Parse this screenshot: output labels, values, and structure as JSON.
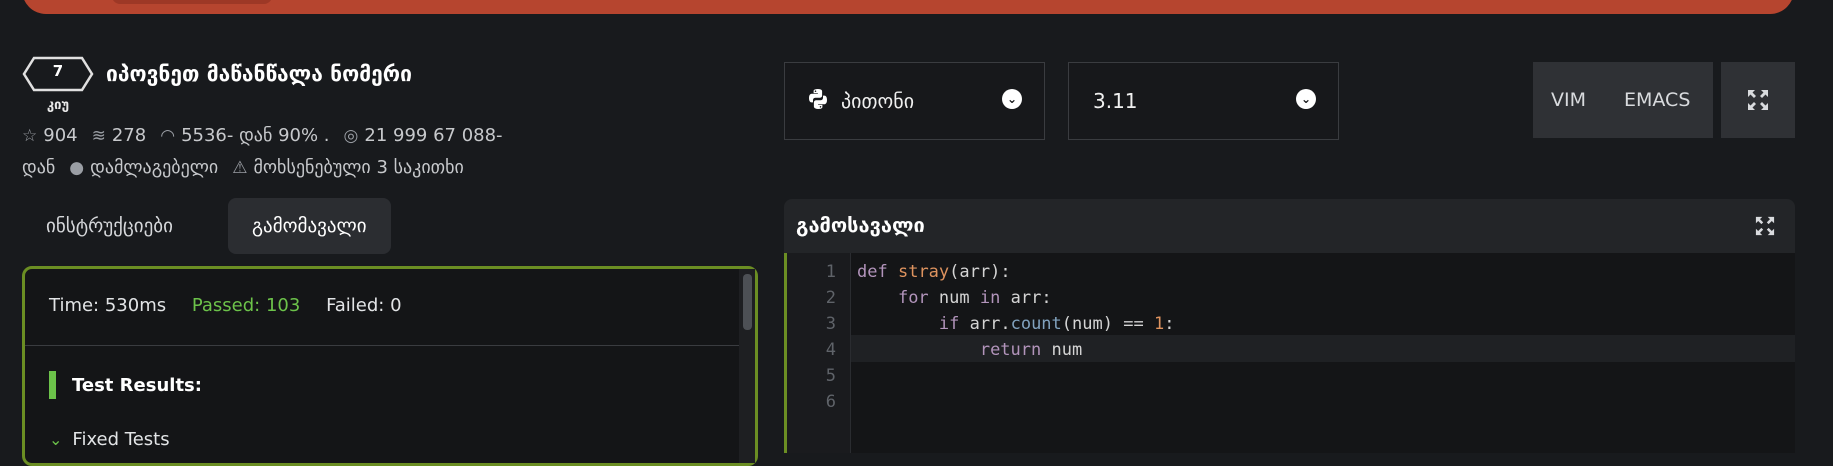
{
  "banner": {
    "color": "#b6452f"
  },
  "kata": {
    "rank": "7",
    "rank_label": "კიუ",
    "title": "იპოვნეთ მაწანწალა ნომერი",
    "stats": {
      "stars": "904",
      "collections": "278",
      "satisfaction": "5536- დან 90% .",
      "completions": "21 999 67 088-",
      "completions_suffix": "დან",
      "author": "დამლაგებელი",
      "issues": "მოხსენებული 3 საკითხი"
    }
  },
  "tabs": [
    {
      "label": "ინსტრუქციები",
      "active": false
    },
    {
      "label": "გამომავალი",
      "active": true
    }
  ],
  "results": {
    "time": "Time: 530ms",
    "passed": "Passed: 103",
    "failed": "Failed: 0",
    "test_results": "Test Results:",
    "fixed_tests": "Fixed Tests"
  },
  "language": {
    "label": "პითონი",
    "icon": "python-icon"
  },
  "version": {
    "label": "3.11"
  },
  "modes": {
    "vim": "VIM",
    "emacs": "EMACS"
  },
  "editor": {
    "title": "გამოსავალი",
    "line_numbers": [
      "1",
      "2",
      "3",
      "4",
      "5",
      "6"
    ],
    "lines": [
      "def stray(arr):",
      "    for num in arr:",
      "        if arr.count(num) == 1:",
      "            return num",
      "",
      ""
    ]
  },
  "colors": {
    "accent_green": "#6cc24a",
    "border_green": "#6b8e23",
    "brand_red": "#b6452f"
  }
}
